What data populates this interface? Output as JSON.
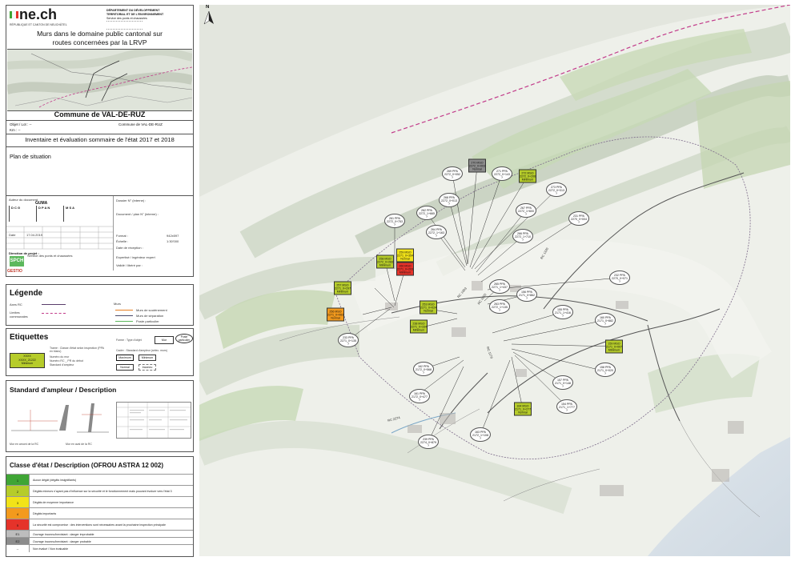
{
  "header": {
    "logo": "ne.ch",
    "logo_sub": "RÉPUBLIQUE ET CANTON DE NEUCHÂTEL",
    "dept_1": "DÉPARTEMENT DU DÉVELOPPEMENT",
    "dept_2": "TERRITORIAL ET DE L'ENVIRONNEMENT",
    "service": "Service des ponts et chaussées",
    "title_line1": "Murs dans le domaine public cantonal sur",
    "title_line2": "routes concernées par la LRVP"
  },
  "commune": "Commune de VAL-DE-RUZ",
  "fields": {
    "objet_label": "Objet / Lot : --",
    "km_label": "Km : --",
    "commune_small": "Commune de VAL-DE-RUZ"
  },
  "inventaire": "Inventaire et évaluation sommaire de l'état 2017 et 2018",
  "plan_situation": "Plan de situation",
  "title_block": {
    "auteur": "Auteur du document",
    "guma": "GUMA",
    "dossier": "Dossier N° (interne) :",
    "document": "Document / plan N° (interne) :",
    "date_label": "Date",
    "date_value": "17.04.2019",
    "format_label": "Format :",
    "format_value": "942x597",
    "echelle_label": "Échelle :",
    "echelle_value": "1:30'000",
    "direction": "Direction de projet :",
    "service_ponts": "Service des ponts et chaussées",
    "gestio": "GESTIO",
    "reception": "Date de réception :",
    "expertise": "Expertisé / ingénieur expert",
    "valide": "Validé / libéré par :"
  },
  "legende": {
    "title": "Légende",
    "axes_rc": "Axes RC",
    "limites": "Limites communales",
    "murs": "Murs",
    "soutenement": "Murs de soutènement",
    "separation": "Murs de séparation",
    "poste": "Poste particulier"
  },
  "etiquettes": {
    "title": "Etiquettes",
    "sample_1": "XXXX",
    "sample_2": "XXXX_21222",
    "sample_3": "Minimum",
    "desc_1": "Trame : Classe d'état selon inspection (PPA en blanc)",
    "desc_2": "Numéro du mur",
    "desc_3": "Numéro RC _ PR du début",
    "desc_4": "Standard d'ampleur",
    "forme_label": "Forme : Type d'objet",
    "forme_mur": "Mur",
    "forme_poste": "Poste particulier",
    "cadre_label": "Cadre : Standard d'ampleur (sélec. murs)",
    "std_max": "Maximum",
    "std_min": "Minimum",
    "std_normal": "Normal",
    "std_inconnu": "Inconnu"
  },
  "standard": {
    "title": "Standard d'ampleur / Description",
    "cap1": "Mur en amont de la RC",
    "cap2": "Mur en aval de la RC"
  },
  "classe": {
    "title": "Classe d'état / Description (OFROU ASTRA 12 002)",
    "rows": [
      {
        "code": "1",
        "text": "Aucun dégât (dégâts insignifiants)",
        "color": "#3fa535"
      },
      {
        "code": "2",
        "text": "Dégâts mineurs n'ayant pas d'influence sur la sécurité et le fonctionnement mais pouvant évoluer vers l'état 3",
        "color": "#b6cc2a"
      },
      {
        "code": "3",
        "text": "Dégâts de moyenne importance",
        "color": "#f2e318"
      },
      {
        "code": "4",
        "text": "Dégâts importants",
        "color": "#f39a1d"
      },
      {
        "code": "5",
        "text": "La sécurité est compromise : des interventions sont nécessaires avant la prochaine inspection principale",
        "color": "#e5332a"
      },
      {
        "code": "E1",
        "text": "Ouvrage inconnu/inexistant : danger improbable",
        "color": "#bdbdbd"
      },
      {
        "code": "E2",
        "text": "Ouvrage inconnu/inexistant : danger probable",
        "color": "#8c8c8c"
      },
      {
        "code": "--",
        "text": "Non évalué / Non évaluable",
        "color": "#ffffff"
      }
    ]
  },
  "map": {
    "north": "N",
    "road_labels": [
      "RC 1320",
      "RC 1003",
      "RC 1170",
      "RC 2274",
      "RC 1003"
    ],
    "labels": [
      {
        "id": "l1",
        "l1": "270 MSO",
        "l2": "2272_0+003",
        "l3": "Normal",
        "shape": "sq",
        "color": "#8c8c8c"
      },
      {
        "id": "l2",
        "l1": "269 PPA",
        "l2": "2272_0+052",
        "l3": "?",
        "shape": "ov",
        "color": "#ffffff"
      },
      {
        "id": "l3",
        "l1": "271 PPA",
        "l2": "2272_0+143",
        "l3": "?",
        "shape": "ov",
        "color": "#ffffff"
      },
      {
        "id": "l4",
        "l1": "272 MSO",
        "l2": "2272_0+206",
        "l3": "Minimum",
        "shape": "sq",
        "color": "#b6cc2a"
      },
      {
        "id": "l5",
        "l1": "268 PPA",
        "l2": "2272_0+013",
        "l3": "?",
        "shape": "ov",
        "color": "#ffffff"
      },
      {
        "id": "l6",
        "l1": "273 PPA",
        "l2": "2272_0+313",
        "l3": "?",
        "shape": "ov",
        "color": "#ffffff"
      },
      {
        "id": "l7",
        "l1": "262 PPA",
        "l2": "2272_1+665",
        "l3": "?",
        "shape": "ov",
        "color": "#ffffff"
      },
      {
        "id": "l8",
        "l1": "267 PPA",
        "l2": "2272_1+600",
        "l3": "?",
        "shape": "ov",
        "color": "#ffffff"
      },
      {
        "id": "l9",
        "l1": "261 PPA",
        "l2": "2272_0+753",
        "l3": "?",
        "shape": "ov",
        "color": "#ffffff"
      },
      {
        "id": "l10",
        "l1": "264 PPA",
        "l2": "2272_1+163",
        "l3": "?",
        "shape": "ov",
        "color": "#ffffff"
      },
      {
        "id": "l11",
        "l1": "266 PPA",
        "l2": "2272_1+710",
        "l3": "?",
        "shape": "ov",
        "color": "#ffffff"
      },
      {
        "id": "l12",
        "l1": "231 PPA",
        "l2": "2270_0+004",
        "l3": "?",
        "shape": "ov",
        "color": "#ffffff"
      },
      {
        "id": "l13",
        "l1": "258 MSO",
        "l2": "2272_0+283",
        "l3": "Minimum",
        "shape": "sq",
        "color": "#b6cc2a"
      },
      {
        "id": "l14",
        "l1": "259 MSO",
        "l2": "2271_0+354",
        "l3": "Normal",
        "shape": "sq",
        "color": "#f2e318"
      },
      {
        "id": "l15",
        "l1": "260 MSO",
        "l2": "2271_0+203",
        "l3": "Minimum",
        "shape": "sq",
        "color": "#e5332a"
      },
      {
        "id": "l16",
        "l1": "232 PPA",
        "l2": "2270_0+071",
        "l3": "?",
        "shape": "ov",
        "color": "#ffffff"
      },
      {
        "id": "l17",
        "l1": "257 MSO",
        "l2": "2271_0+297",
        "l3": "Minimum",
        "shape": "sq",
        "color": "#b6cc2a"
      },
      {
        "id": "l18",
        "l1": "265 PPA",
        "l2": "2271_1+437",
        "l3": "?",
        "shape": "ov",
        "color": "#ffffff"
      },
      {
        "id": "l19",
        "l1": "156 PPA",
        "l2": "2171_0+862",
        "l3": "?",
        "shape": "ov",
        "color": "#ffffff"
      },
      {
        "id": "l20",
        "l1": "263 PPA",
        "l2": "2272_1+135",
        "l3": "?",
        "shape": "ov",
        "color": "#ffffff"
      },
      {
        "id": "l21",
        "l1": "253 MSO",
        "l2": "2271_0+024",
        "l3": "Normal",
        "shape": "sq",
        "color": "#b6cc2a"
      },
      {
        "id": "l22",
        "l1": "256 MSO",
        "l2": "2271_0+063",
        "l3": "Normal",
        "shape": "sq",
        "color": "#f39a1d"
      },
      {
        "id": "l23",
        "l1": "155 PPA",
        "l2": "2171_1+416",
        "l3": "?",
        "shape": "ov",
        "color": "#ffffff"
      },
      {
        "id": "l24",
        "l1": "160 PPA",
        "l2": "2171_0+882",
        "l3": "?",
        "shape": "ov",
        "color": "#ffffff"
      },
      {
        "id": "l25",
        "l1": "238 MSO",
        "l2": "2271_0+334",
        "l3": "Minimum",
        "shape": "sq",
        "color": "#b6cc2a"
      },
      {
        "id": "l26",
        "l1": "233 PPA",
        "l2": "2271_0+135",
        "l3": "?",
        "shape": "ov",
        "color": "#ffffff"
      },
      {
        "id": "l27",
        "l1": "159 MSO",
        "l2": "2171_0+007",
        "l3": "Minimum",
        "shape": "sq",
        "color": "#b6cc2a"
      },
      {
        "id": "l28",
        "l1": "158 PPA",
        "l2": "2171_0+020",
        "l3": "?",
        "shape": "ov",
        "color": "#ffffff"
      },
      {
        "id": "l29",
        "l1": "162 PPA",
        "l2": "2172_0+568",
        "l3": "?",
        "shape": "ov",
        "color": "#ffffff"
      },
      {
        "id": "l30",
        "l1": "157 PPA",
        "l2": "2171_0+148",
        "l3": "?",
        "shape": "ov",
        "color": "#ffffff"
      },
      {
        "id": "l31",
        "l1": "161 PPA",
        "l2": "2172_0+477",
        "l3": "?",
        "shape": "ov",
        "color": "#ffffff"
      },
      {
        "id": "l32",
        "l1": "164 MSO",
        "l2": "2171_0+277",
        "l3": "Normal",
        "shape": "sq",
        "color": "#b6cc2a"
      },
      {
        "id": "l33",
        "l1": "154 PPA",
        "l2": "2171_1+777",
        "l3": "?",
        "shape": "ov",
        "color": "#ffffff"
      },
      {
        "id": "l34",
        "l1": "163 PPA",
        "l2": "2172_1+108",
        "l3": "?",
        "shape": "ov",
        "color": "#ffffff"
      },
      {
        "id": "l35",
        "l1": "239 PPA",
        "l2": "2274_0+879",
        "l3": "?",
        "shape": "ov",
        "color": "#ffffff"
      }
    ]
  }
}
